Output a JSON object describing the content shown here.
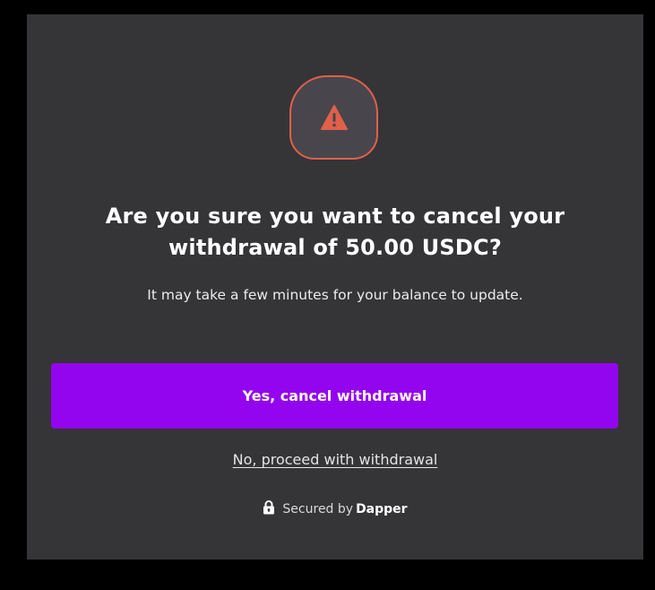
{
  "dialog": {
    "title_line1": "Are you sure you want to cancel your",
    "title_line2": "withdrawal of 50.00 USDC?",
    "subtitle": "It may take a few minutes for your balance to update.",
    "confirm_label": "Yes, cancel withdrawal",
    "dismiss_label": "No, proceed with withdrawal",
    "secured_prefix": "Secured by",
    "secured_brand": "Dapper",
    "icon": "warning-icon",
    "lock_icon": "lock-icon"
  },
  "colors": {
    "page_background": "#000000",
    "modal_background": "#353437",
    "icon_badge_fill": "#48464c",
    "warning_accent": "#e0604a",
    "primary_button": "#9305ee",
    "text_primary": "#ffffff",
    "text_secondary": "#ebebed"
  }
}
